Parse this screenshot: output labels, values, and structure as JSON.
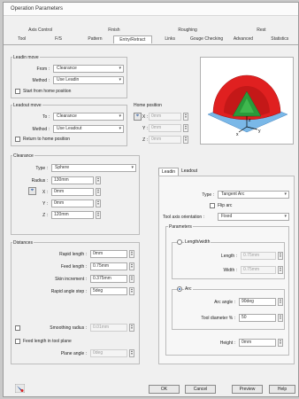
{
  "window": {
    "title": "Operation Parameters"
  },
  "tabs_top": [
    "Axis Control",
    "Finish",
    "Roughing",
    "Rest"
  ],
  "tabs_bottom": [
    "Tool",
    "F/S",
    "Pattern",
    "Entry/Retract",
    "Links",
    "Gouge Checking",
    "Advanced",
    "Statistics"
  ],
  "active_tab": "Entry/Retract",
  "leadin_move": {
    "title": "Leadin move",
    "from_label": "From :",
    "from_value": "Clearance",
    "method_label": "Method :",
    "method_value": "Use Leadin",
    "start_label": "Start from home position"
  },
  "leadout_move": {
    "title": "Leadout move",
    "to_label": "To :",
    "to_value": "Clearance",
    "method_label": "Method :",
    "method_value": "Use Leadout",
    "return_label": "Return to home position"
  },
  "home_position": {
    "title": "Home position",
    "x_label": "X :",
    "x_value": "0mm",
    "y_label": "Y :",
    "y_value": "0mm",
    "z_label": "Z :",
    "z_value": "0mm"
  },
  "clearance": {
    "title": "Clearance",
    "type_label": "Type :",
    "type_value": "Sphere",
    "radius_label": "Radius :",
    "radius_value": "130mm",
    "x_label": "X :",
    "x_value": "0mm",
    "y_label": "Y :",
    "y_value": "0mm",
    "z_label": "Z :",
    "z_value": "120mm"
  },
  "distances": {
    "title": "Distances",
    "rapid_label": "Rapid length :",
    "rapid_value": "0mm",
    "feed_label": "Feed length :",
    "feed_value": "0.75mm",
    "skin_label": "Skin increment :",
    "skin_value": "0.375mm",
    "rapid_step_label": "Rapid angle step :",
    "rapid_step_value": "5deg",
    "smooth_label": "Smoothing radius :",
    "smooth_value": "0.01mm",
    "feed_plane_label": "Feed length in tool plane",
    "plane_angle_label": "Plane angle :",
    "plane_angle_value": "0deg"
  },
  "lead_panel": {
    "tab_leadin": "Leadin",
    "tab_leadout": "Leadout",
    "type_label": "Type :",
    "type_value": "Tangent Arc",
    "flip_label": "Flip arc",
    "orient_label": "Tool axis orientation :",
    "orient_value": "Fixed",
    "params_title": "Parameters",
    "lw_label": "Length/width",
    "length_label": "Length :",
    "length_value": "0.75mm",
    "width_label": "Width :",
    "width_value": "0.75mm",
    "arc_label": "Arc",
    "arc_angle_label": "Arc angle :",
    "arc_angle_value": "90deg",
    "tool_diam_label": "Tool diameter % :",
    "tool_diam_value": "50",
    "height_label": "Height :",
    "height_value": "0mm"
  },
  "buttons": {
    "ok": "OK",
    "cancel": "Cancel",
    "preview": "Preview",
    "help": "Help"
  },
  "preview_axes": {
    "x": "x",
    "y": "y",
    "z": "z"
  },
  "colors": {
    "dome": "#e02020",
    "cone": "#2a9a3a",
    "plane": "#7ab8e8",
    "accent": "#1a5bb5"
  }
}
